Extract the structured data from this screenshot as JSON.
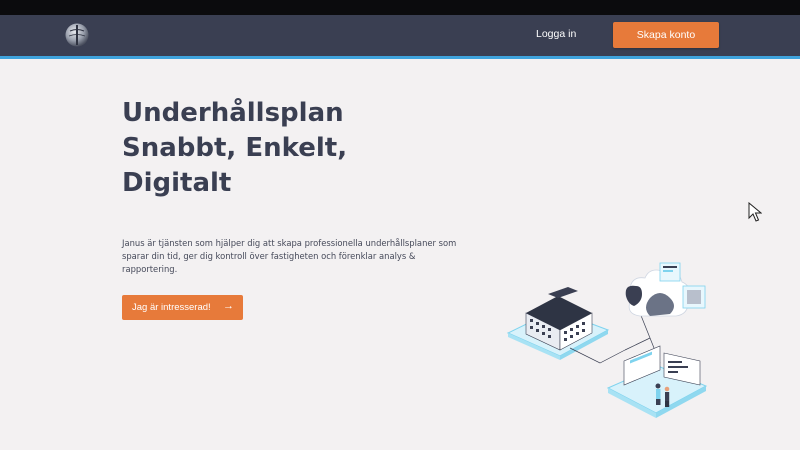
{
  "header": {
    "logo_icon": "globe-logo-icon",
    "login_label": "Logga in",
    "signup_label": "Skapa konto"
  },
  "hero": {
    "title_lines": [
      "Underhållsplan",
      "Snabbt, Enkelt,",
      "Digitalt"
    ],
    "description": "Janus är tjänsten som hjälper dig att skapa professionella underhållsplaner som sparar din tid, ger dig kontroll över fastigheten och förenklar analys & rapportering.",
    "cta_label": "Jag är intresserad!",
    "cta_icon": "arrow-right-icon"
  },
  "colors": {
    "navbar": "#3a3f52",
    "accent": "#e77a3a",
    "nav_border": "#3fa3dc",
    "background": "#f3f1f2",
    "title_text": "#3a3f52"
  },
  "illustration_icon": "building-cloud-dashboard-illustration"
}
